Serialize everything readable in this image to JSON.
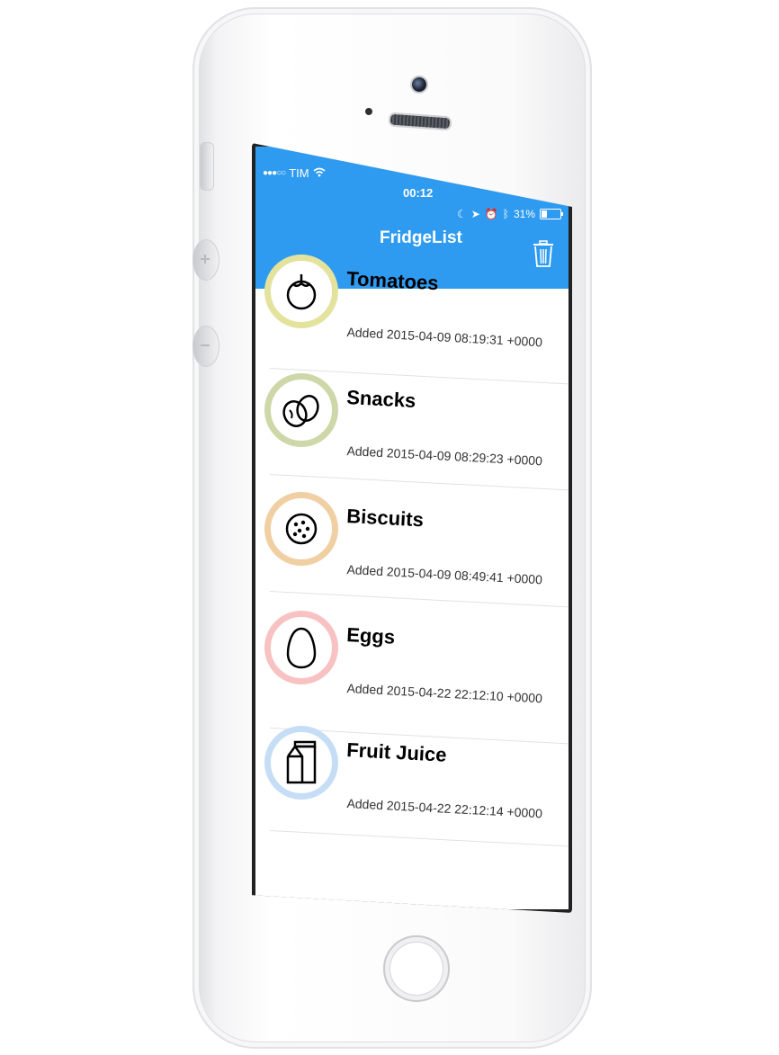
{
  "status_bar": {
    "signal": "●●●○○",
    "carrier": "TIM",
    "time": "00:12",
    "battery": "31%"
  },
  "navbar": {
    "title": "FridgeList",
    "trash_icon": "trash-icon",
    "color": "#2f9bf0"
  },
  "items": [
    {
      "name": "Tomatoes",
      "added": "Added 2015-04-09 08:19:31 +0000",
      "icon": "tomato-icon",
      "ring_color": "#e3e39e"
    },
    {
      "name": "Snacks",
      "added": "Added 2015-04-09 08:29:23 +0000",
      "icon": "snacks-icon",
      "ring_color": "#cdd7a8"
    },
    {
      "name": "Biscuits",
      "added": "Added 2015-04-09 08:49:41 +0000",
      "icon": "biscuit-icon",
      "ring_color": "#f0cfa3"
    },
    {
      "name": "Eggs",
      "added": "Added 2015-04-22 22:12:10 +0000",
      "icon": "egg-icon",
      "ring_color": "#f8c2c2"
    },
    {
      "name": "Fruit Juice",
      "added": "Added 2015-04-22 22:12:14 +0000",
      "icon": "juice-carton-icon",
      "ring_color": "#c5def5"
    }
  ]
}
